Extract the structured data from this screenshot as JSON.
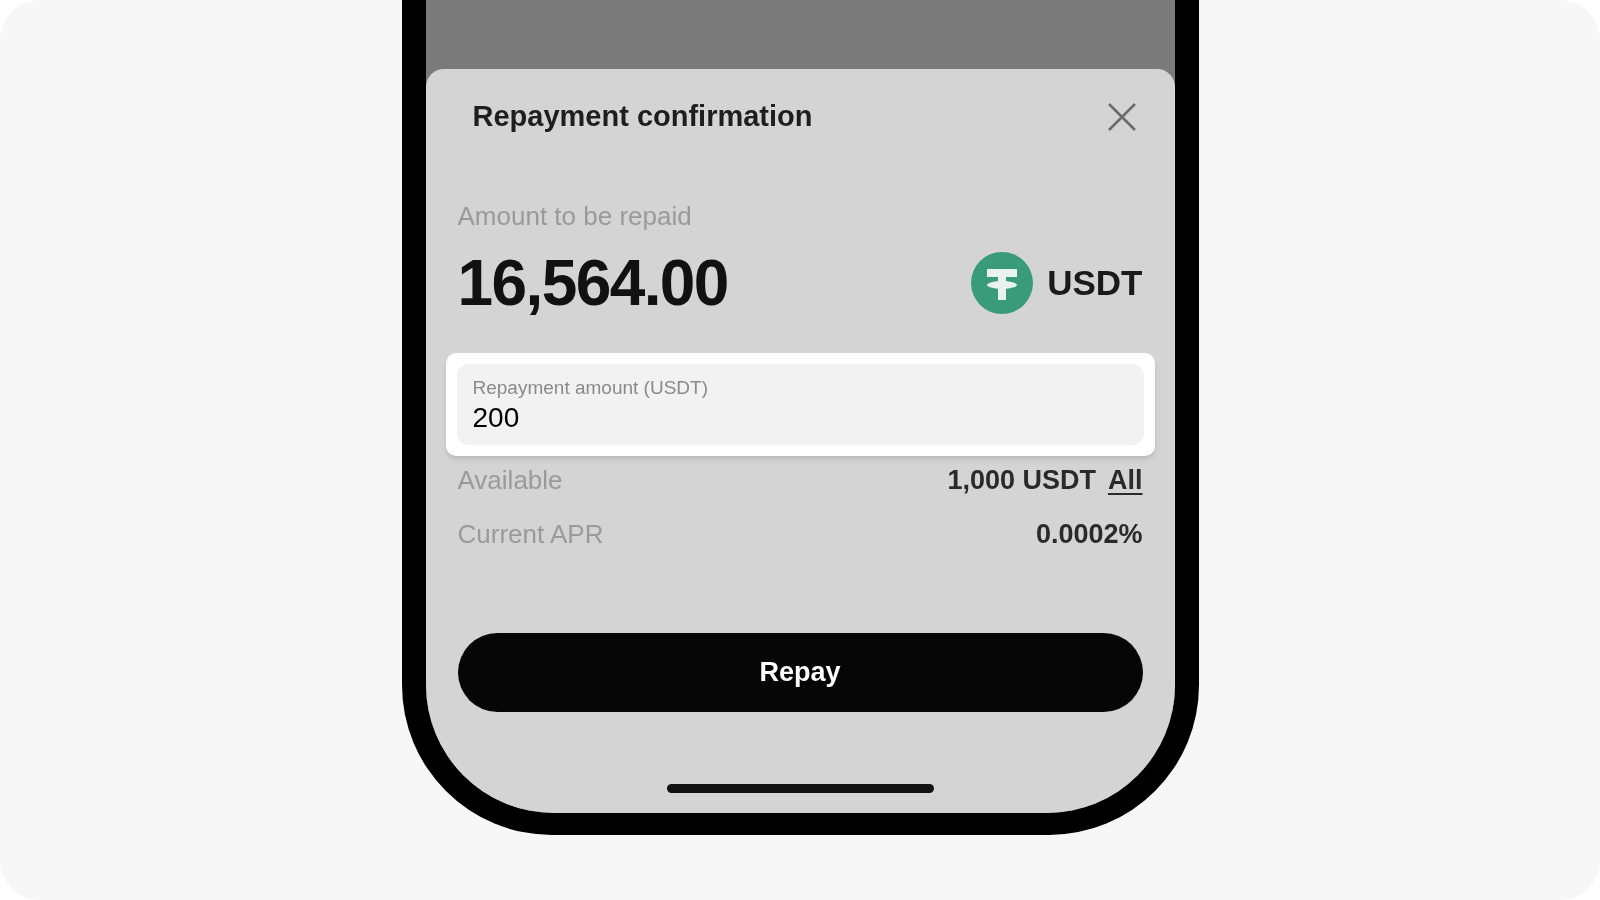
{
  "sheet": {
    "title": "Repayment confirmation",
    "amount_label": "Amount to be repaid",
    "amount": "16,564.00",
    "currency": "USDT",
    "field": {
      "label": "Repayment amount (USDT)",
      "value": "200"
    },
    "rows": [
      {
        "label": "Available",
        "value": "1,000 USDT",
        "link": "All"
      },
      {
        "label": "Current APR",
        "value": "0.0002%"
      }
    ],
    "button": "Repay"
  }
}
